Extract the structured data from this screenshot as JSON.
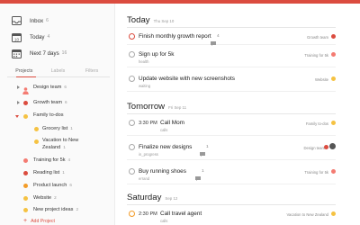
{
  "colors": {
    "accent": "#db4c3f",
    "orange": "#f39c28",
    "yellow": "#f5c242",
    "pink": "#f47b72",
    "lightorange": "#f7b04d"
  },
  "filters": [
    {
      "label": "Inbox",
      "count": "6",
      "icon": "inbox-icon"
    },
    {
      "label": "Today",
      "count": "4",
      "icon": "calendar-today-icon"
    },
    {
      "label": "Next 7 days",
      "count": "16",
      "icon": "calendar-week-icon"
    }
  ],
  "tabs": [
    "Projects",
    "Labels",
    "Filters"
  ],
  "projects": [
    {
      "label": "Design team",
      "count": "6",
      "icon": "person-icon",
      "color": "#f47b72",
      "arrow": "right"
    },
    {
      "label": "Growth team",
      "count": "6",
      "icon": "dot",
      "color": "#db4c3f",
      "arrow": "right"
    },
    {
      "label": "Family to-dos",
      "count": "",
      "icon": "dot",
      "color": "#f5c242",
      "arrow": "down"
    },
    {
      "label": "Grocery list",
      "count": "1",
      "icon": "dot",
      "color": "#f5c242",
      "arrow": "none"
    },
    {
      "label": "Vacation to New",
      "label2": "Zealand",
      "count": "1",
      "icon": "dot",
      "color": "#f5c242",
      "arrow": "none"
    },
    {
      "label": "Training for 5k",
      "count": "4",
      "icon": "dot",
      "color": "#f47b72",
      "arrow": "none"
    },
    {
      "label": "Reading list",
      "count": "1",
      "icon": "dot",
      "color": "#db4c3f",
      "arrow": "none"
    },
    {
      "label": "Product launch",
      "count": "6",
      "icon": "dot",
      "color": "#f39c28",
      "arrow": "none"
    },
    {
      "label": "Website",
      "count": "2",
      "icon": "dot",
      "color": "#f5c242",
      "arrow": "none"
    },
    {
      "label": "New project ideas",
      "count": "2",
      "icon": "dot",
      "color": "#f5c242",
      "arrow": "none"
    }
  ],
  "add_project": "Add Project",
  "days": [
    {
      "title": "Today",
      "sub": "Thu Sep 10",
      "tasks": [
        {
          "title": "Finish monthly growth report",
          "note": "4",
          "sub": "",
          "project": "Growth team",
          "pcolor": "#db4c3f",
          "check": "red"
        },
        {
          "title": "Sign up for 5k",
          "note": "",
          "sub": "health",
          "project": "Training for 5k",
          "pcolor": "#f47b72",
          "check": ""
        },
        {
          "title": "Update website with new screenshots",
          "note": "",
          "sub": "waiting",
          "project": "Website",
          "pcolor": "#f5c242",
          "check": ""
        }
      ]
    },
    {
      "title": "Tomorrow",
      "sub": "Fri Sep 11",
      "tasks": [
        {
          "time": "3:30 PM",
          "title": "Call Mom",
          "note": "",
          "sub": "calls",
          "project": "Family to-dos",
          "pcolor": "#f5c242",
          "check": ""
        },
        {
          "title": "Finalize new designs",
          "note": "1",
          "sub": "in_progress",
          "project": "Design team",
          "pcolor": "#db4c3f",
          "check": "",
          "avatar": true
        },
        {
          "title": "Buy running shoes",
          "note": "1",
          "sub": "errand",
          "project": "Training for 5k",
          "pcolor": "#f47b72",
          "check": ""
        }
      ]
    },
    {
      "title": "Saturday",
      "sub": "Sep 12",
      "tasks": [
        {
          "time": "2:30 PM",
          "title": "Call travel agent",
          "note": "",
          "sub": "calls",
          "project": "Vacation to New Zealand",
          "pcolor": "#f5c242",
          "check": "orange"
        }
      ]
    }
  ]
}
